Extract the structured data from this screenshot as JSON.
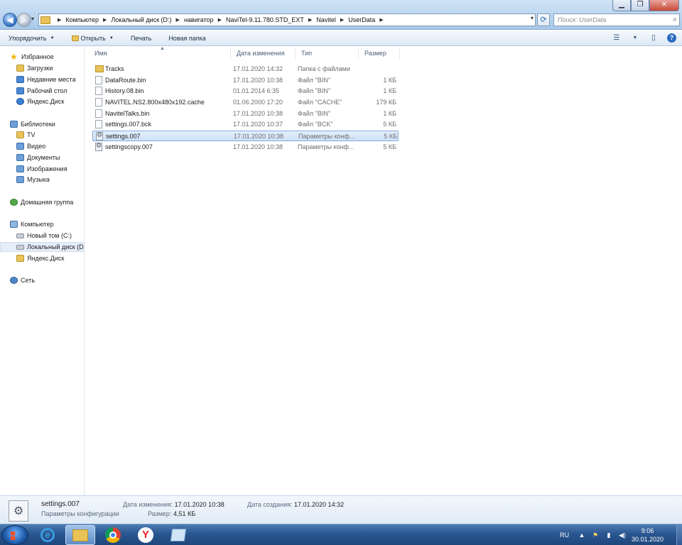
{
  "window": {
    "controls": {
      "minimize": "▁",
      "maximize": "❐",
      "close": "✕"
    }
  },
  "address": {
    "crumbs": [
      "Компьютер",
      "Локальный диск (D:)",
      "навигатор",
      "NaviTel-9.11.780.STD_EXT",
      "Navitel",
      "UserData"
    ],
    "search_placeholder": "Поиск: UserData"
  },
  "toolbar": {
    "organize": "Упорядочить",
    "open": "Открыть",
    "print": "Печать",
    "new_folder": "Новая папка"
  },
  "navpane": {
    "favorites": "Избранное",
    "downloads": "Загрузки",
    "recent": "Недавние места",
    "desktop": "Рабочий стол",
    "yandex_disk_fav": "Яндекс.Диск",
    "libraries": "Библиотеки",
    "tv": "TV",
    "video": "Видео",
    "documents": "Документы",
    "images": "Изображения",
    "music": "Музыка",
    "homegroup": "Домашняя группа",
    "computer": "Компьютер",
    "drive_c": "Новый том (C:)",
    "drive_d": "Локальный диск (D",
    "yandex_disk": "Яндекс.Диск",
    "network": "Сеть"
  },
  "columns": {
    "name": "Имя",
    "date": "Дата изменения",
    "type": "Тип",
    "size": "Размер"
  },
  "files": [
    {
      "name": "Tracks",
      "date": "17.01.2020 14:32",
      "type": "Папка с файлами",
      "size": "",
      "icon": "folder-icon"
    },
    {
      "name": "DataRoute.bin",
      "date": "17.01.2020 10:38",
      "type": "Файл \"BIN\"",
      "size": "1 КБ",
      "icon": "file-icon"
    },
    {
      "name": "History.08.bin",
      "date": "01.01.2014 6:35",
      "type": "Файл \"BIN\"",
      "size": "1 КБ",
      "icon": "file-icon"
    },
    {
      "name": "NAVITEL.NS2.800x480x192.cache",
      "date": "01.06.2000 17:20",
      "type": "Файл \"CACHE\"",
      "size": "179 КБ",
      "icon": "file-icon"
    },
    {
      "name": "NavitelTalks.bin",
      "date": "17.01.2020 10:38",
      "type": "Файл \"BIN\"",
      "size": "1 КБ",
      "icon": "file-icon"
    },
    {
      "name": "settings.007.bck",
      "date": "17.01.2020 10:37",
      "type": "Файл \"BCK\"",
      "size": "5 КБ",
      "icon": "file-icon"
    },
    {
      "name": "settings.007",
      "date": "17.01.2020 10:38",
      "type": "Параметры конф...",
      "size": "5 КБ",
      "icon": "config-file-icon"
    },
    {
      "name": "settingscopy.007",
      "date": "17.01.2020 10:38",
      "type": "Параметры конф...",
      "size": "5 КБ",
      "icon": "config-file-icon"
    }
  ],
  "selected_file_index": 6,
  "details": {
    "name": "settings.007",
    "kind": "Параметры конфигурации",
    "modified_label": "Дата изменения:",
    "modified_value": "17.01.2020 10:38",
    "size_label": "Размер:",
    "size_value": "4,51 КБ",
    "created_label": "Дата создания:",
    "created_value": "17.01.2020 14:32"
  },
  "taskbar": {
    "apps": [
      "internet-explorer-icon",
      "windows-explorer-icon",
      "chrome-icon",
      "yandex-browser-icon",
      "file-manager-icon"
    ],
    "active_app": "windows-explorer-icon",
    "language": "RU",
    "time": "9:06",
    "date": "30.01.2020"
  },
  "colors": {
    "accent": "#2c6bc0",
    "selection": "#cfe2f8",
    "taskbar": "#2a5790"
  }
}
